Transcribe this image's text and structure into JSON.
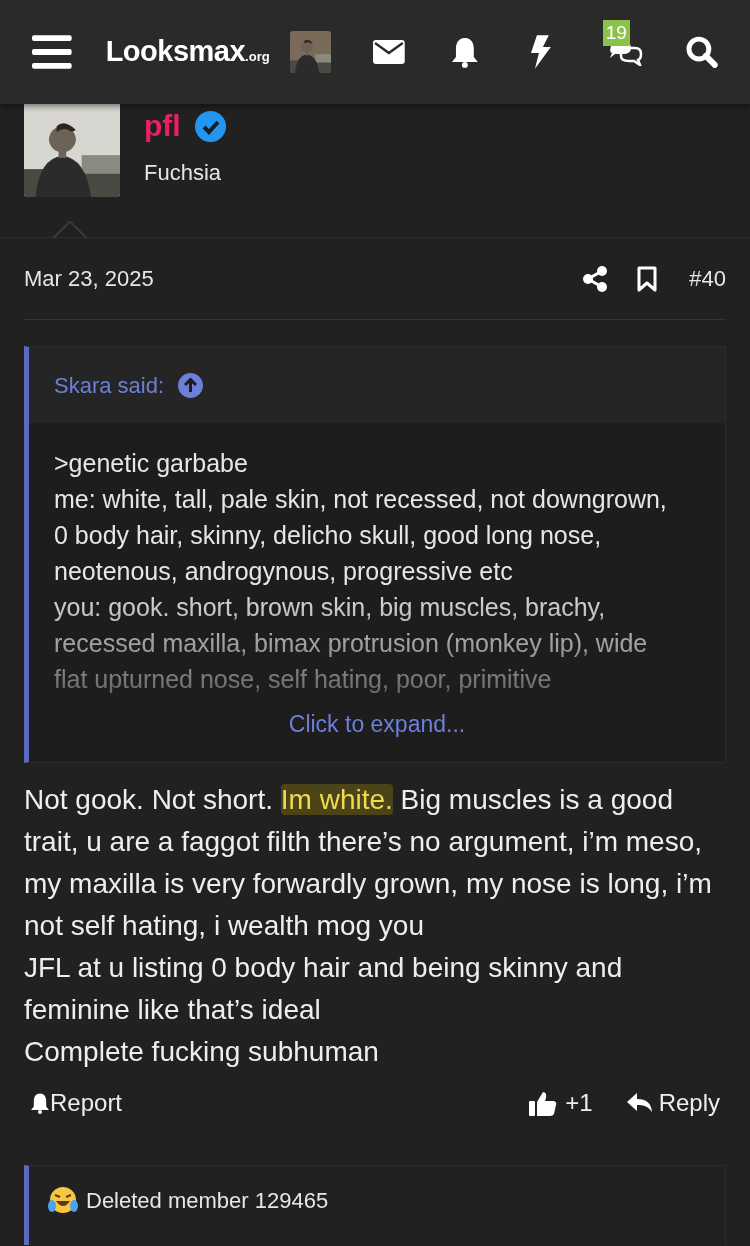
{
  "header": {
    "logo": "Looksmax",
    "logo_suffix": ".org",
    "badge": "19"
  },
  "post": {
    "author": "pfl",
    "verified": true,
    "user_title": "Fuchsia",
    "date": "Mar 23, 2025",
    "number": "#40",
    "quote": {
      "author": "Skara said:",
      "lines": [
        ">genetic garbabe",
        "me: white, tall, pale skin, not recessed, not downgrown, 0 body hair, skinny, delicho skull, good long nose, neotenous, androgynous, progressive etc",
        "you: gook. short, brown skin, big muscles, brachy, recessed maxilla, bimax protrusion (monkey lip), wide flat upturned nose, self hating, poor, primitive"
      ],
      "expand": "Click to expand..."
    },
    "body": [
      [
        {
          "text": "Not gook. Not short. ",
          "highlighted": false
        },
        {
          "text": "Im white.",
          "highlighted": true
        },
        {
          "text": " Big muscles is a good trait, u are a faggot filth there’s no argument, i’m meso, my maxilla is very forwardly grown, my nose is long, i’m not self hating, i wealth mog you",
          "highlighted": false
        }
      ],
      [
        {
          "text": "JFL at u listing 0 body hair and being skinny and feminine like that’s ideal",
          "highlighted": false
        }
      ],
      [
        {
          "text": "Complete fucking subhuman",
          "highlighted": false
        }
      ]
    ],
    "actions": {
      "report": "Report",
      "reaction_count": "+1",
      "reply": "Reply"
    },
    "reactions": {
      "summary": "Deleted member 129465"
    }
  }
}
